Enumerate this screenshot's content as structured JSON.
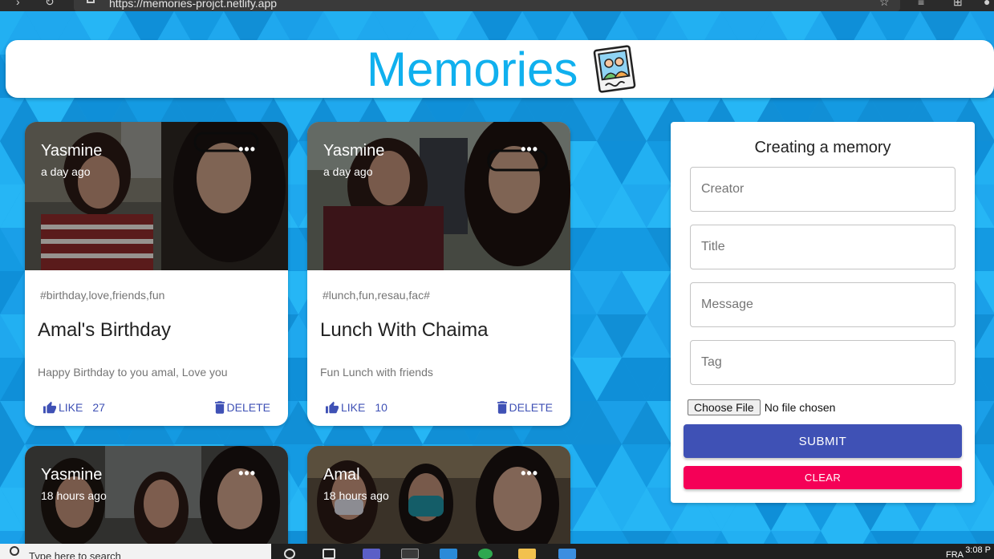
{
  "browser": {
    "url": "https://memories-projct.netlify.app"
  },
  "header": {
    "title": "Memories",
    "logo_icon": "polaroid-photo-icon"
  },
  "posts": [
    {
      "creator": "Yasmine",
      "time": "a day ago",
      "tags": "#birthday,love,friends,fun",
      "title": "Amal's Birthday",
      "message": "Happy Birthday to you amal, Love you",
      "like_label": "LIKE",
      "like_count": "27",
      "delete_label": "DELETE",
      "more": "•••"
    },
    {
      "creator": "Yasmine",
      "time": "a day ago",
      "tags": "#lunch,fun,resau,fac#",
      "title": "Lunch With Chaima",
      "message": "Fun Lunch with friends",
      "like_label": "LIKE",
      "like_count": "10",
      "delete_label": "DELETE",
      "more": "•••"
    },
    {
      "creator": "Yasmine",
      "time": "18 hours ago",
      "more": "•••"
    },
    {
      "creator": "Amal",
      "time": "18 hours ago",
      "more": "•••"
    }
  ],
  "form": {
    "title": "Creating a memory",
    "creator_placeholder": "Creator",
    "title_placeholder": "Title",
    "message_placeholder": "Message",
    "tag_placeholder": "Tag",
    "file_button": "Choose File",
    "file_status": "No file chosen",
    "submit_label": "SUBMIT",
    "clear_label": "CLEAR"
  },
  "taskbar": {
    "search_placeholder": "Type here to search",
    "language": "FRA",
    "time": "3:08 P"
  },
  "colors": {
    "accent": "#3f51b5",
    "secondary": "#f50057",
    "title_blue": "#10b0ee",
    "background": "#18a0e6"
  }
}
